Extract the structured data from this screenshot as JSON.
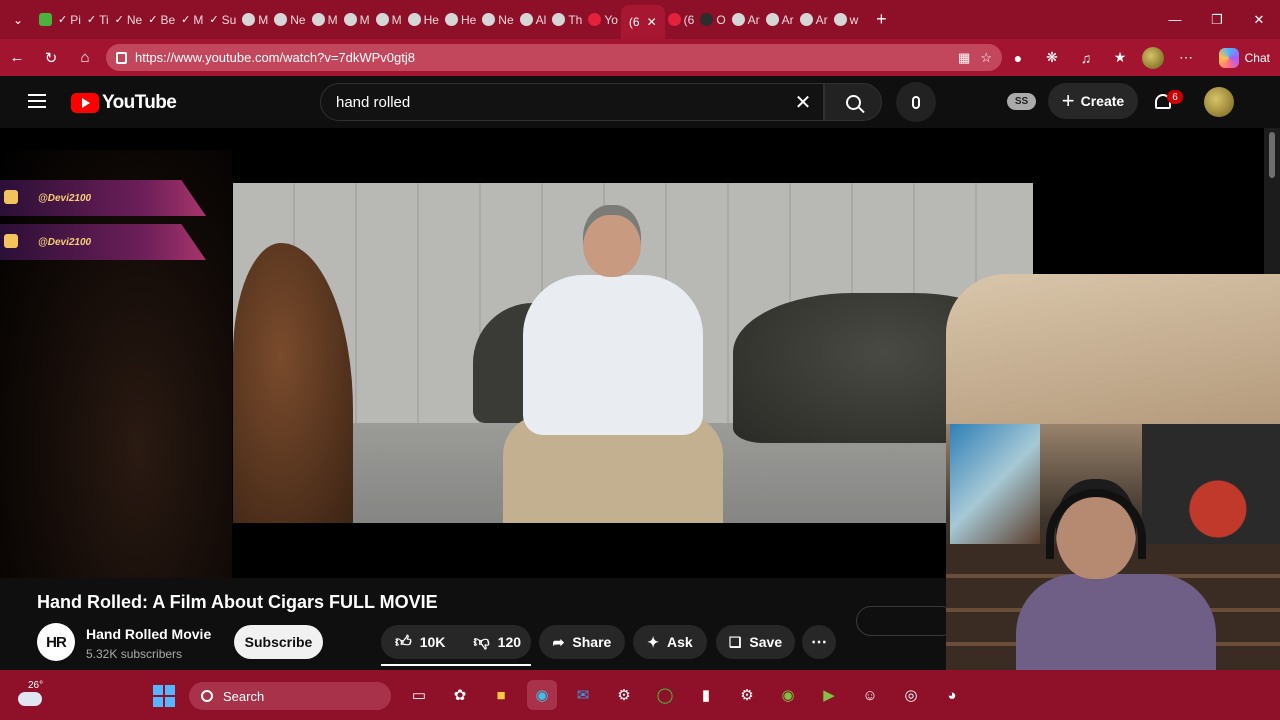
{
  "browser": {
    "tabs": [
      {
        "label": "",
        "favicon": "teams-icon"
      },
      {
        "label": "Pi",
        "favicon": "check-icon"
      },
      {
        "label": "Ti",
        "favicon": "check-icon"
      },
      {
        "label": "Ne",
        "favicon": "check-icon"
      },
      {
        "label": "Be",
        "favicon": "check-icon"
      },
      {
        "label": "M",
        "favicon": "check-icon"
      },
      {
        "label": "Su",
        "favicon": "check-icon"
      },
      {
        "label": "M",
        "favicon": "face-icon"
      },
      {
        "label": "Ne",
        "favicon": "face-icon"
      },
      {
        "label": "M",
        "favicon": "face-icon"
      },
      {
        "label": "M",
        "favicon": "face-icon"
      },
      {
        "label": "M",
        "favicon": "face-icon"
      },
      {
        "label": "He",
        "favicon": "face-icon"
      },
      {
        "label": "He",
        "favicon": "face-icon"
      },
      {
        "label": "Ne",
        "favicon": "face-icon"
      },
      {
        "label": "Al",
        "favicon": "face-icon"
      },
      {
        "label": "Th",
        "favicon": "face-icon"
      },
      {
        "label": "Yo",
        "favicon": "youtube-icon"
      }
    ],
    "active_tab": {
      "label": "(6"
    },
    "trailing_tabs": [
      {
        "label": "(6",
        "favicon": "youtube-icon"
      },
      {
        "label": "O",
        "favicon": "dark-icon"
      },
      {
        "label": "Ar",
        "favicon": "a-icon"
      },
      {
        "label": "Ar",
        "favicon": "a-icon"
      },
      {
        "label": "Ar",
        "favicon": "a-icon"
      },
      {
        "label": "w",
        "favicon": "chrome-icon"
      }
    ],
    "url": "https://www.youtube.com/watch?v=7dkWPv0gtj8",
    "chat_label": "Chat"
  },
  "youtube": {
    "logo_text": "YouTube",
    "search_query": "hand rolled",
    "ss_badge": "SS",
    "create_label": "Create",
    "notification_count": "6"
  },
  "overlay": {
    "twitter_handle": "@Devi2100",
    "youtube_handle": "@Devi2100"
  },
  "video": {
    "title": "Hand Rolled: A Film About Cigars FULL MOVIE",
    "channel_initials": "HR",
    "channel_name": "Hand Rolled Movie",
    "subscribers": "5.32K subscribers",
    "subscribe_label": "Subscribe",
    "likes": "10K",
    "dislikes": "120",
    "share_label": "Share",
    "ask_label": "Ask",
    "save_label": "Save"
  },
  "taskbar": {
    "temperature": "26°",
    "search_placeholder": "Search",
    "apps": [
      "task-view-icon",
      "copilot-icon",
      "file-explorer-icon",
      "edge-icon",
      "outlook-icon",
      "settings-icon",
      "xbox-icon",
      "epic-games-icon",
      "steam-icon",
      "nvidia-icon",
      "nvidia-broadcast-icon",
      "discord-icon",
      "obs-icon",
      "speedometer-icon"
    ]
  },
  "colors": {
    "browser_frame": "#8e1028",
    "youtube_red": "#ff0000",
    "page_background": "#0f0f0f"
  }
}
